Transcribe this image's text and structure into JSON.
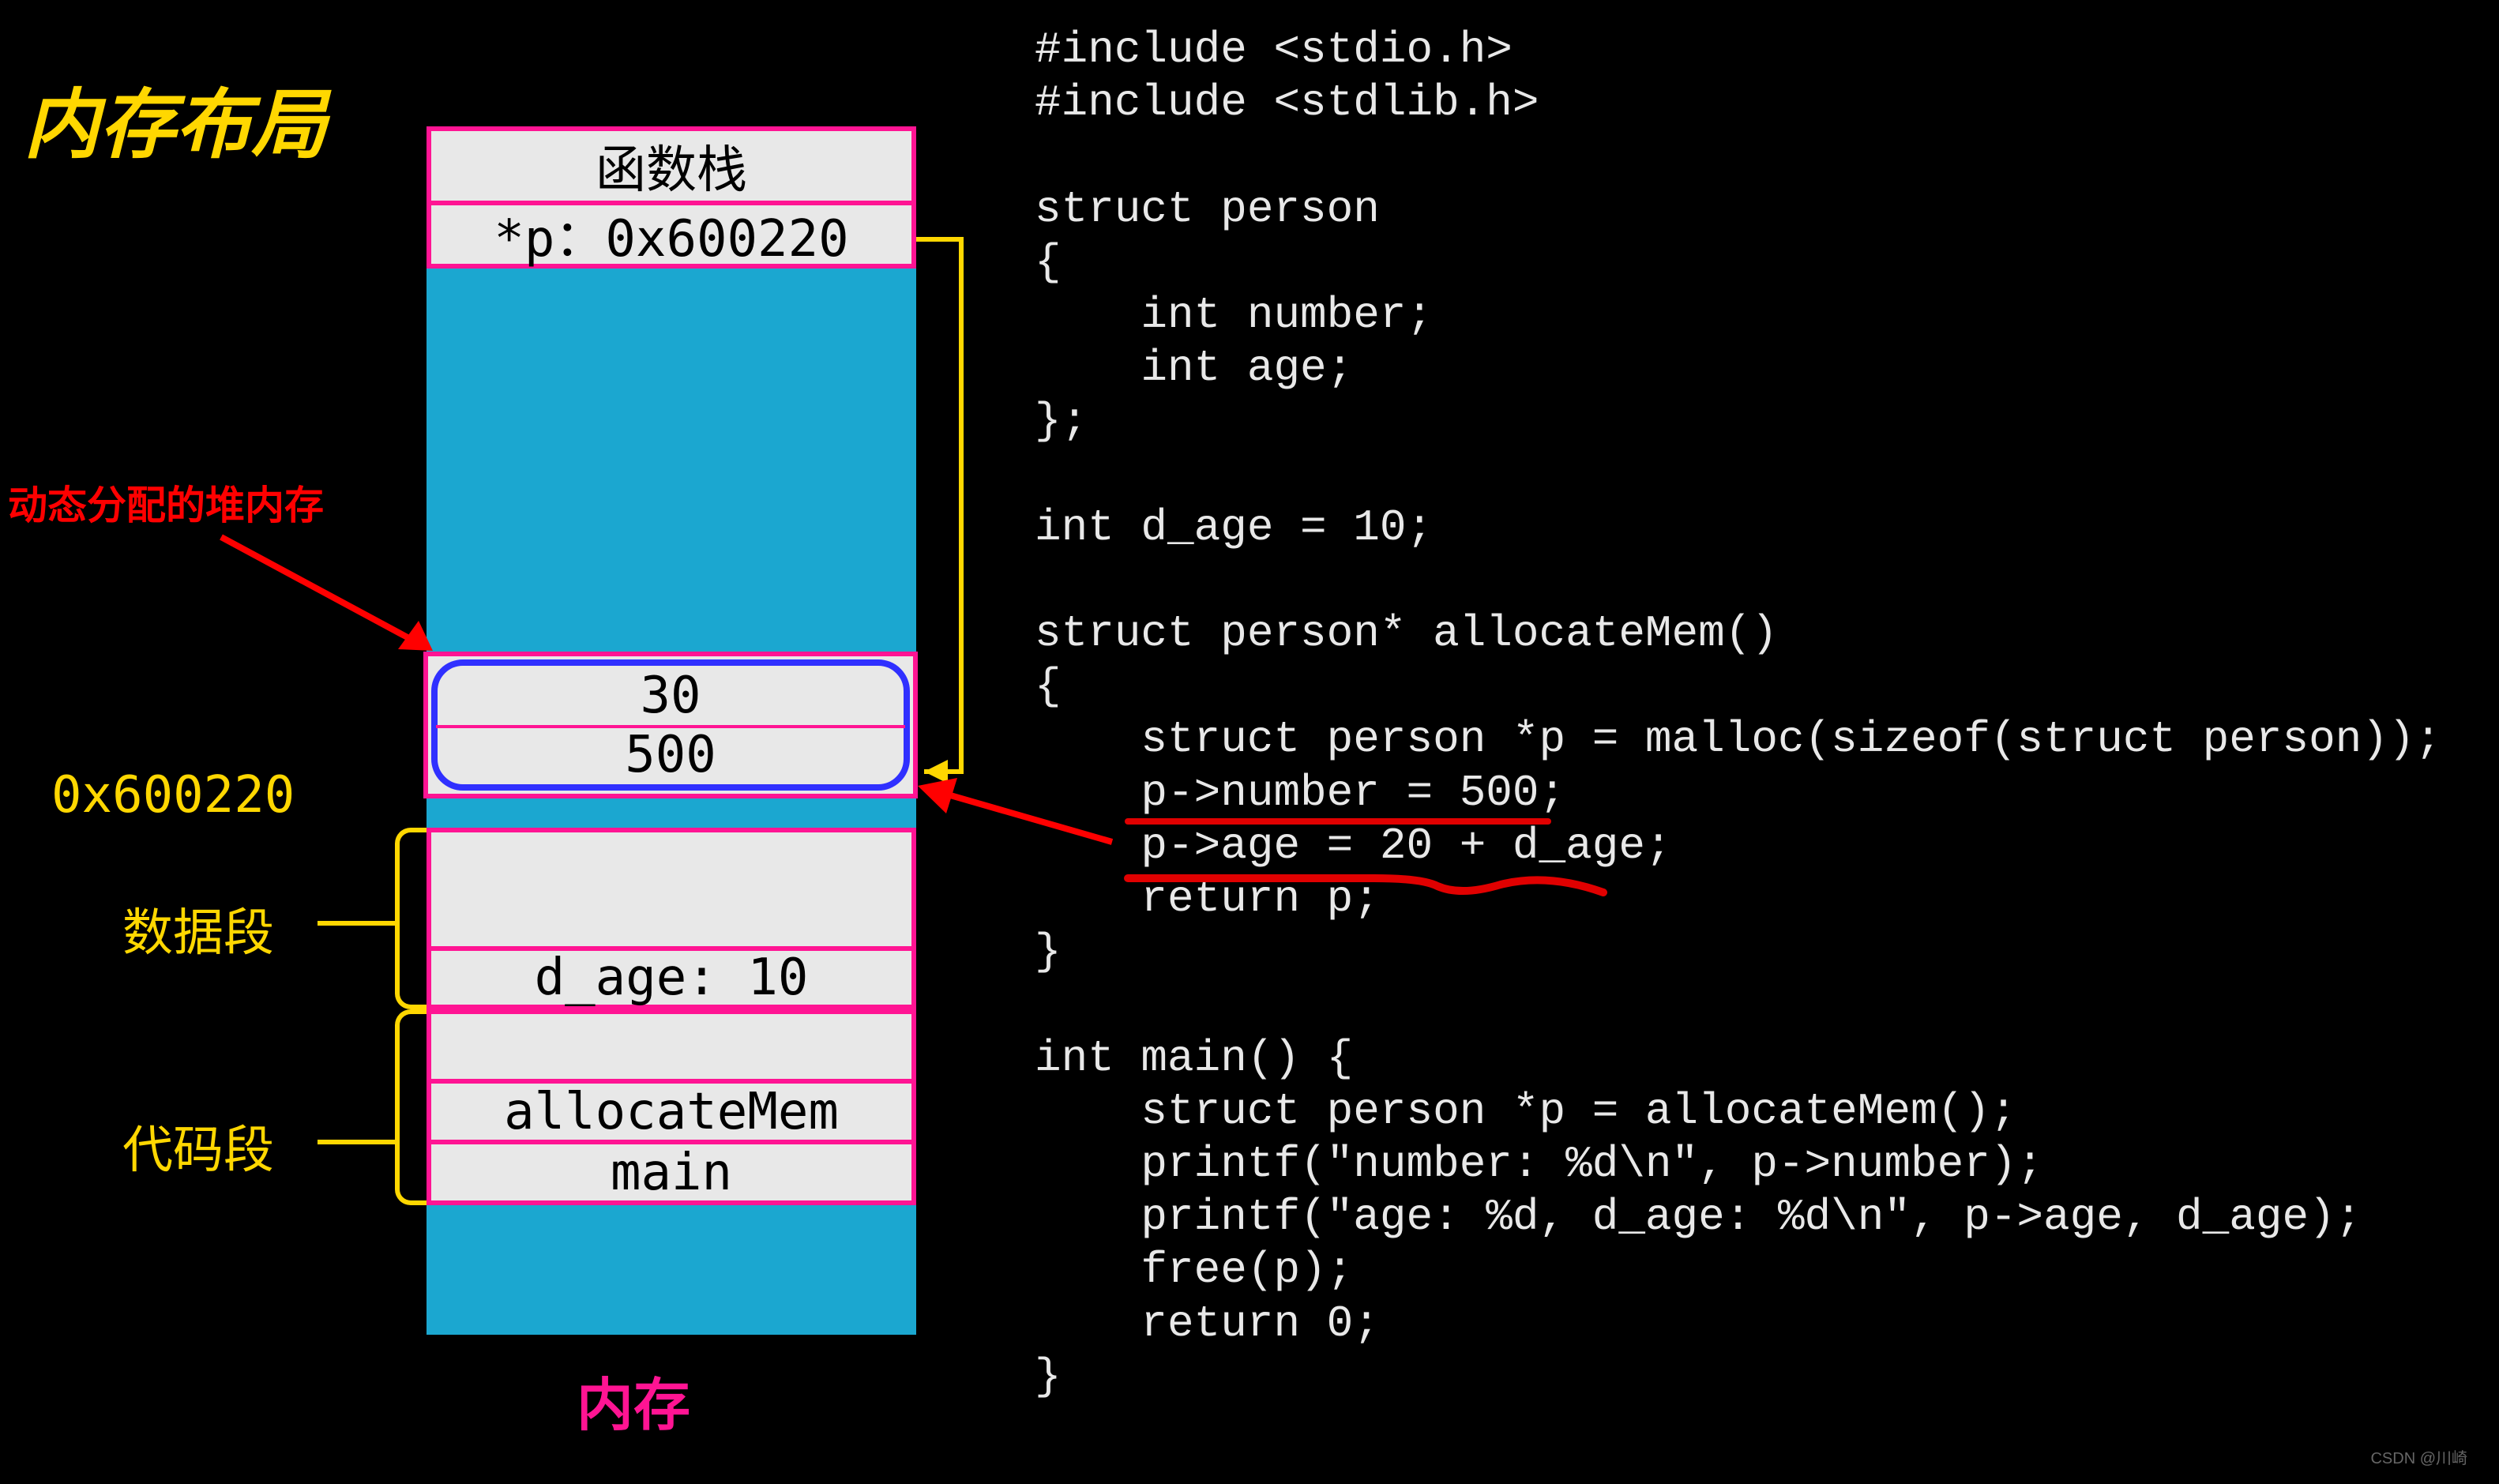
{
  "title": "内存布局",
  "heap_label": "动态分配的堆内存",
  "addr_label": "0x600220",
  "data_seg_label": "数据段",
  "code_seg_label": "代码段",
  "mem_label": "内存",
  "stack": {
    "name": "函数栈",
    "p_label": "*p：0x600220"
  },
  "heap": {
    "row1": "30",
    "row2": "500"
  },
  "data_seg": {
    "d_age": "d_age: 10"
  },
  "code_seg": {
    "alloc": "allocateMem",
    "main": "main"
  },
  "code_lines": [
    "#include <stdio.h>",
    "#include <stdlib.h>",
    "",
    "struct person",
    "{",
    "    int number;",
    "    int age;",
    "};",
    "",
    "int d_age = 10;",
    "",
    "struct person* allocateMem()",
    "{",
    "    struct person *p = malloc(sizeof(struct person));",
    "    p->number = 500;",
    "    p->age = 20 + d_age;",
    "    return p;",
    "}",
    "",
    "int main() {",
    "    struct person *p = allocateMem();",
    "    printf(\"number: %d\\n\", p->number);",
    "    printf(\"age: %d, d_age: %d\\n\", p->age, d_age);",
    "    free(p);",
    "    return 0;",
    "}"
  ],
  "watermark": "CSDN @川崎"
}
